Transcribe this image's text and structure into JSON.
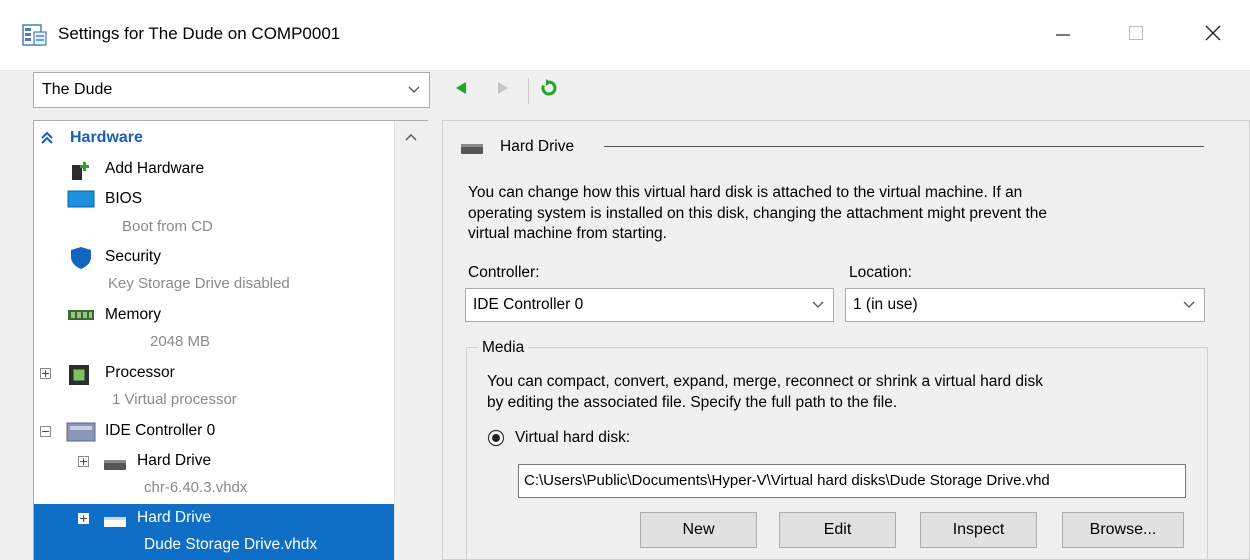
{
  "window": {
    "title": "Settings for The Dude on COMP0001"
  },
  "vm_selector": {
    "value": "The Dude"
  },
  "tree": {
    "section_header": "Hardware",
    "items": [
      {
        "label": "Add Hardware",
        "sublabel": ""
      },
      {
        "label": "BIOS",
        "sublabel": "Boot from CD"
      },
      {
        "label": "Security",
        "sublabel": "Key Storage Drive disabled"
      },
      {
        "label": "Memory",
        "sublabel": "2048 MB"
      },
      {
        "label": "Processor",
        "sublabel": "1 Virtual processor"
      },
      {
        "label": "IDE Controller 0",
        "sublabel": ""
      },
      {
        "label": "Hard Drive",
        "sublabel": "chr-6.40.3.vhdx"
      },
      {
        "label": "Hard Drive",
        "sublabel": "Dude Storage Drive.vhdx"
      }
    ]
  },
  "details": {
    "group_title": "Hard Drive",
    "description_lines": [
      "You can change how this virtual hard disk is attached to the virtual machine. If an",
      "operating system is installed on this disk, changing the attachment might prevent the",
      "virtual machine from starting."
    ],
    "controller_label": "Controller:",
    "controller_value": "IDE Controller 0",
    "location_label": "Location:",
    "location_value": "1 (in use)",
    "media_title": "Media",
    "media_lines": [
      "You can compact, convert, expand, merge, reconnect or shrink a virtual hard disk",
      "by editing the associated file. Specify the full path to the file."
    ],
    "vhd_radio_label": "Virtual hard disk:",
    "vhd_path": "C:\\Users\\Public\\Documents\\Hyper-V\\Virtual hard disks\\Dude Storage Drive.vhd",
    "buttons": {
      "new": "New",
      "edit": "Edit",
      "inspect": "Inspect",
      "browse": "Browse..."
    }
  },
  "colors": {
    "selection": "#0f6fc6",
    "accent_green": "#22a62a",
    "header_blue": "#1a5fb4"
  }
}
